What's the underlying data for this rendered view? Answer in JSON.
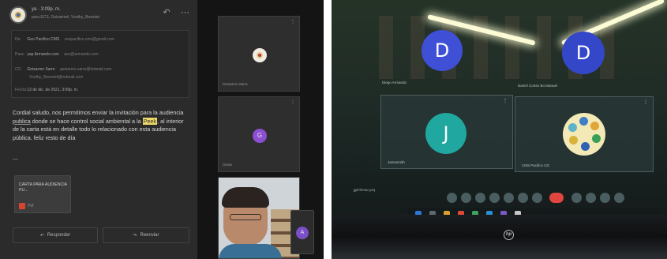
{
  "email": {
    "sender_name": "ya · 3:09p. m.",
    "sender_sub": "para ECS, Geisarmel, Voothy_Bowntet",
    "details": {
      "from_label": "De:",
      "from_name": "Geo Pacifico CMS",
      "from_email": "cespacifico.cms@gmail.com",
      "to_label": "Para:",
      "to_name": "yap Armando.com",
      "to_email": "aoc@armando.com",
      "cc_label": "CC:",
      "cc_name": "Geisarmo Sarre",
      "cc_email": "geisarmo.sarre@hotmail.com",
      "cc_email2": "Voothy_Bowntet@hotmail.com",
      "date_label": "Fecha:",
      "date_value": "13 de dic. de 2021, 3:09p. m."
    },
    "body_part1": "Cordial saludo, nos permitimos enviar la invitación para la audiencia ",
    "body_underlined": "publica",
    "body_part2": " donde se hace control social ambiental a la ",
    "body_highlight": "Peek",
    "body_part3": ", al interior de la carta está en detalle todo lo relacionado con esta audiencia pública. feliz resto de día",
    "signature": "—",
    "attachment": {
      "title": "CARTA PARA AUDIENCIA PU...",
      "size": "Pdf"
    },
    "reply_label": "Responder",
    "forward_label": "Reenviar"
  },
  "meeting_left": {
    "tile1_label": "Geisarmo Sarre",
    "tile2_label": "Geisa",
    "tile2_initial": "G",
    "self_initial": "A"
  },
  "meeting_right": {
    "avatar1_initial": "D",
    "avatar2_initial": "D",
    "avatar3_initial": "J",
    "label_d1": "Diego Armando",
    "label_d2": "Daniel Cortes Bo Manuel",
    "label_j": "Jamesmith",
    "label_logo": "CMS Pacifico GG",
    "meeting_info": "jgd-hmsu-yzq",
    "brand": "hp"
  },
  "colors": {
    "avatar_d1": "#3f4fd6",
    "avatar_d2": "#3447c8",
    "avatar_j": "#1fa7a0",
    "highlight": "#efd96a",
    "end_call": "#e0463d"
  }
}
